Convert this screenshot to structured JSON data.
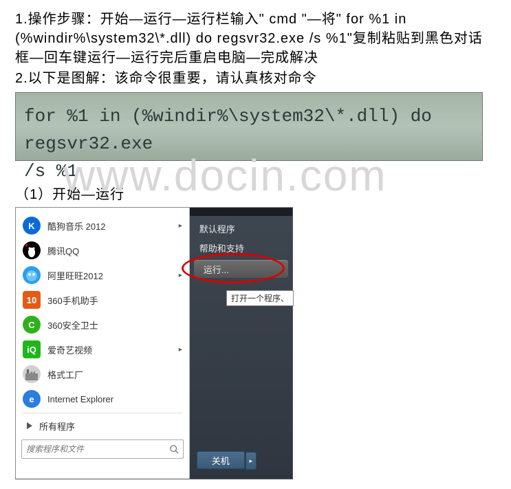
{
  "para1": "1.操作步骤：开始―运行―运行栏输入\" cmd \"―将\" for %1 in (%windir%\\system32\\*.dll) do regsvr32.exe /s %1\"复制粘贴到黑色对话框―回车键运行―运行完后重启电脑―完成解决",
  "para2": "2.以下是图解：该命令很重要，请认真核对命令",
  "cmd_line1": "for %1 in (%windir%\\system32\\*.dll) do regsvr32.exe",
  "cmd_line2": "/s %1",
  "watermark": "www.docin.com",
  "step_label": "（1）开始—运行",
  "start_menu": {
    "left_items": [
      {
        "label": "酷狗音乐 2012",
        "icon_bg": "#0a6bd6",
        "icon_txt": "K",
        "arrow": true
      },
      {
        "label": "腾讯QQ",
        "icon_bg": "#000",
        "icon_txt": "Q",
        "arrow": false,
        "penguin": true
      },
      {
        "label": "阿里旺旺2012",
        "icon_bg": "#2a9df4",
        "icon_txt": "",
        "arrow": true,
        "wangwang": true
      },
      {
        "label": "360手机助手",
        "icon_bg": "#e35b16",
        "icon_txt": "10",
        "arrow": false,
        "square": true
      },
      {
        "label": "360安全卫士",
        "icon_bg": "#2eb21a",
        "icon_txt": "C",
        "arrow": false
      },
      {
        "label": "爱奇艺视频",
        "icon_bg": "#1fb51b",
        "icon_txt": "iQ",
        "arrow": true,
        "square": true
      },
      {
        "label": "格式工厂",
        "icon_bg": "#d0d0d0",
        "icon_txt": "",
        "arrow": false,
        "factory": true
      },
      {
        "label": "Internet Explorer",
        "icon_bg": "#2a7de1",
        "icon_txt": "e",
        "arrow": false
      }
    ],
    "all_programs": "所有程序",
    "search_placeholder": "搜索程序和文件",
    "right_items": {
      "default_programs": "默认程序",
      "help": "帮助和支持",
      "run": "运行...",
      "tooltip": "打开一个程序、",
      "shutdown": "关机"
    }
  }
}
